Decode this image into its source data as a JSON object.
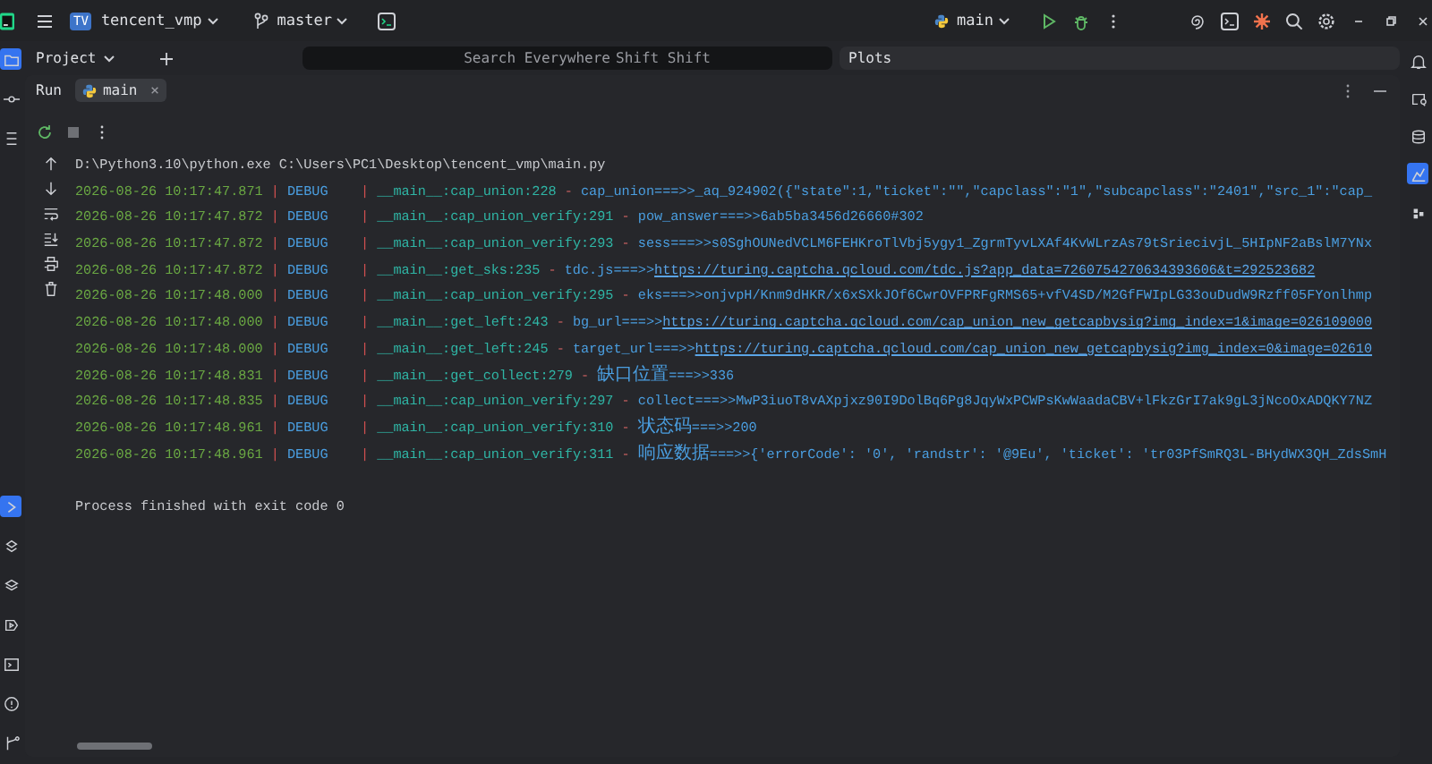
{
  "title_bar": {
    "project_badge": "TV",
    "project": "tencent_vmp",
    "branch": "master",
    "run_configuration": "main"
  },
  "left_strip": {
    "top": [
      {
        "selected": true
      },
      {
        "selected": false
      },
      {
        "selected": false
      }
    ],
    "bottom": [
      {
        "selected": true
      },
      {
        "selected": false
      },
      {
        "selected": false
      },
      {
        "selected": false
      },
      {
        "selected": false
      },
      {
        "selected": false
      },
      {
        "selected": false
      }
    ]
  },
  "right_strip": [
    {
      "selected": false
    },
    {
      "selected": false
    },
    {
      "selected": false
    },
    {
      "selected": true
    },
    {
      "selected": false
    }
  ],
  "project_panel": {
    "title": "Project"
  },
  "search": {
    "placeholder": "Search Everywhere",
    "shortcut": "Shift Shift"
  },
  "plots_panel": {
    "title": "Plots"
  },
  "run_panel": {
    "title": "Run",
    "tabs": [
      {
        "label": "main",
        "selected": true
      }
    ],
    "command": "D:\\Python3.10\\python.exe C:\\Users\\PC1\\Desktop\\tencent_vmp\\main.py",
    "log": [
      {
        "time": "2026-08-26 10:17:47.871",
        "separators": [
          "|",
          "|",
          "-"
        ],
        "level": "DEBUG",
        "location": "__main__:cap_union:228",
        "message": "cap_union===>>_aq_924902({\"state\":1,\"ticket\":\"\",\"capclass\":\"1\",\"subcapclass\":\"2401\",\"src_1\":\"cap_"
      },
      {
        "time": "2026-08-26 10:17:47.872",
        "separators": [
          "|",
          "|",
          "-"
        ],
        "level": "DEBUG",
        "location": "__main__:cap_union_verify:291",
        "message": "pow_answer===>>6ab5ba3456d26660#302"
      },
      {
        "time": "2026-08-26 10:17:47.872",
        "separators": [
          "|",
          "|",
          "-"
        ],
        "level": "DEBUG",
        "location": "__main__:cap_union_verify:293",
        "message": "sess===>>s0SghOUNedVCLM6FEHKroTlVbj5ygy1_ZgrmTyvLXAf4KvWLrzAs79tSriecivjL_5HIpNF2aBslM7YNx"
      },
      {
        "time": "2026-08-26 10:17:47.872",
        "separators": [
          "|",
          "|",
          "-"
        ],
        "level": "DEBUG",
        "location": "__main__:get_sks:235",
        "message": "tdc.js===>>",
        "link": "https://turing.captcha.qcloud.com/tdc.js?app_data=7260754270634393606&t=292523682"
      },
      {
        "time": "2026-08-26 10:17:48.000",
        "separators": [
          "|",
          "|",
          "-"
        ],
        "level": "DEBUG",
        "location": "__main__:cap_union_verify:295",
        "message": "eks===>>onjvpH/Knm9dHKR/x6xSXkJOf6CwrOVFPRFgRMS65+vfV4SD/M2GfFWIpLG33ouDudW9Rzff05FYonlhmp"
      },
      {
        "time": "2026-08-26 10:17:48.000",
        "separators": [
          "|",
          "|",
          "-"
        ],
        "level": "DEBUG",
        "location": "__main__:get_left:243",
        "message": "bg_url===>>",
        "link": "https://turing.captcha.qcloud.com/cap_union_new_getcapbysig?img_index=1&image=026109000"
      },
      {
        "time": "2026-08-26 10:17:48.000",
        "separators": [
          "|",
          "|",
          "-"
        ],
        "level": "DEBUG",
        "location": "__main__:get_left:245",
        "message": "target_url===>>",
        "link": "https://turing.captcha.qcloud.com/cap_union_new_getcapbysig?img_index=0&image=02610"
      },
      {
        "time": "2026-08-26 10:17:48.831",
        "separators": [
          "|",
          "|",
          "-"
        ],
        "level": "DEBUG",
        "location": "__main__:get_collect:279",
        "message": "缺口位置===>>336"
      },
      {
        "time": "2026-08-26 10:17:48.835",
        "separators": [
          "|",
          "|",
          "-"
        ],
        "level": "DEBUG",
        "location": "__main__:cap_union_verify:297",
        "message": "collect===>>MwP3iuoT8vAXpjxz90I9DolBq6Pg8JqyWxPCWPsKwWaadaCBV+lFkzGrI7ak9gL3jNcoOxADQKY7NZ"
      },
      {
        "time": "2026-08-26 10:17:48.961",
        "separators": [
          "|",
          "|",
          "-"
        ],
        "level": "DEBUG",
        "location": "__main__:cap_union_verify:310",
        "message": "状态码===>>200"
      },
      {
        "time": "2026-08-26 10:17:48.961",
        "separators": [
          "|",
          "|",
          "-"
        ],
        "level": "DEBUG",
        "location": "__main__:cap_union_verify:311",
        "message": "响应数据===>>{'errorCode': '0', 'randstr': '@9Eu', 'ticket': 'tr03PfSmRQ3L-BHydWX3QH_ZdsSmH"
      }
    ],
    "exit_message": "Process finished with exit code 0"
  }
}
